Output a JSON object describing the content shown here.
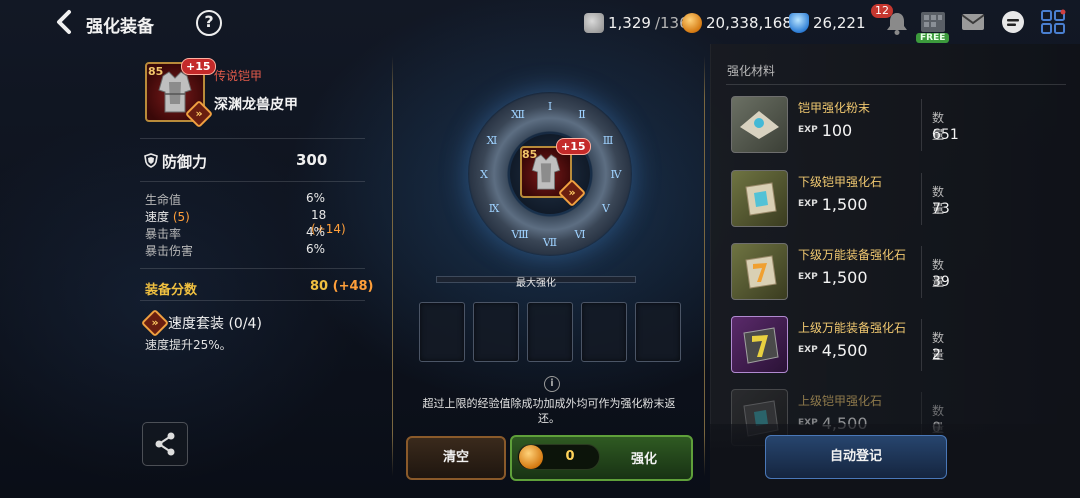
{
  "header": {
    "title": "强化装备",
    "help": "?",
    "stamina": "1,329",
    "stamina_max": "/136",
    "gold": "20,338,168",
    "gems": "26,221",
    "notification_count": "12",
    "shop_tag": "FREE"
  },
  "item": {
    "level": "85",
    "plus": "+15",
    "rarity": "传说铠甲",
    "name": "深渊龙兽皮甲"
  },
  "stats": {
    "main_label": "防御力",
    "main_value": "300",
    "subs": [
      {
        "label": "生命值",
        "label_extra": "",
        "value": "6%",
        "value_extra": ""
      },
      {
        "label": "速度",
        "label_extra": "(5)",
        "value": "18",
        "value_extra": "(+14)"
      },
      {
        "label": "暴击率",
        "label_extra": "",
        "value": "4%",
        "value_extra": ""
      },
      {
        "label": "暴击伤害",
        "label_extra": "",
        "value": "6%",
        "value_extra": ""
      }
    ],
    "score_label": "装备分数",
    "score_value": "80",
    "score_extra": "(+48)"
  },
  "set": {
    "name": "速度套装",
    "progress": "(0/4)",
    "desc": "速度提升25%。"
  },
  "center": {
    "max_label": "最大强化",
    "note": "超过上限的经验值除成功加成外均可作为强化粉末返还。",
    "clear_label": "清空",
    "cost": "0",
    "enhance_label": "强化"
  },
  "materials": {
    "title": "强化材料",
    "qty_label": "数量",
    "items": [
      {
        "name": "铠甲强化粉末",
        "exp": "100",
        "qty": "651"
      },
      {
        "name": "下级铠甲强化石",
        "exp": "1,500",
        "qty": "73"
      },
      {
        "name": "下级万能装备强化石",
        "exp": "1,500",
        "qty": "39"
      },
      {
        "name": "上级万能装备强化石",
        "exp": "4,500",
        "qty": "2"
      },
      {
        "name": "上级铠甲强化石",
        "exp": "4,500",
        "qty": "0"
      }
    ],
    "auto_label": "自动登记"
  },
  "colors": {
    "accent_gold": "#f0c040",
    "bonus_orange": "#ff9f3a",
    "rarity_red": "#e05a4a",
    "enhance_green": "#5fa03a",
    "auto_blue": "#4a78b8"
  }
}
